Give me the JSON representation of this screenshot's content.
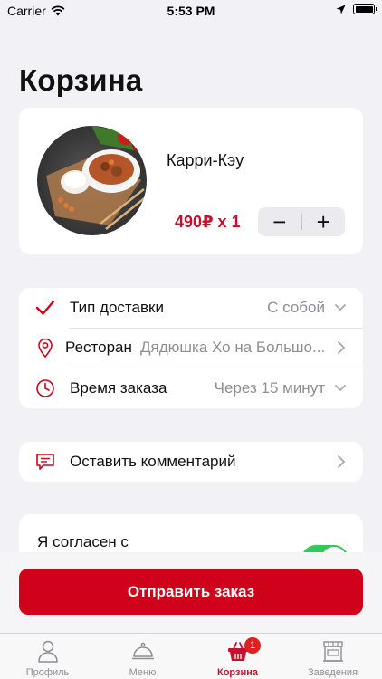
{
  "status_bar": {
    "carrier": "Carrier",
    "time": "5:53 PM"
  },
  "page": {
    "title": "Корзина"
  },
  "cart_item": {
    "name": "Карри-Кэу",
    "price_qty": "490₽ x 1",
    "minus": "−",
    "plus": "+"
  },
  "order_options": [
    {
      "label": "Тип доставки",
      "value": "С собой",
      "icon": "checkmark-icon",
      "chevron": "chevron-down-icon"
    },
    {
      "label": "Ресторан",
      "value": "Дядюшка Хо на Большо...",
      "icon": "location-pin-icon",
      "chevron": "chevron-right-icon"
    },
    {
      "label": "Время заказа",
      "value": "Через 15 минут",
      "icon": "clock-icon",
      "chevron": "chevron-down-icon"
    }
  ],
  "comment": {
    "label": "Оставить комментарий"
  },
  "agreement": {
    "text": "Я согласен с",
    "toggle_on": true
  },
  "submit": {
    "label": "Отправить заказ"
  },
  "tabs": [
    {
      "label": "Профиль",
      "icon": "person-icon",
      "active": false
    },
    {
      "label": "Меню",
      "icon": "cloche-icon",
      "active": false
    },
    {
      "label": "Корзина",
      "icon": "basket-icon",
      "active": true,
      "badge": "1"
    },
    {
      "label": "Заведения",
      "icon": "store-icon",
      "active": false
    }
  ],
  "colors": {
    "accent": "#d0021b",
    "price": "#c8102e",
    "toggle": "#34c759",
    "background": "#f2f2f6"
  }
}
